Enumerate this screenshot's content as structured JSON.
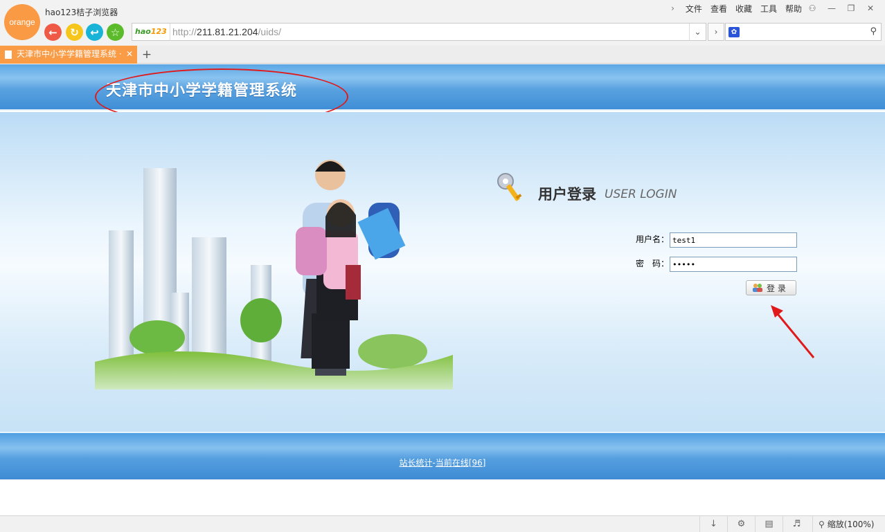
{
  "browser": {
    "logo_text": "orange",
    "app_name": "hao123桔子浏览器",
    "menu": [
      "文件",
      "查看",
      "收藏",
      "工具",
      "帮助"
    ],
    "address": {
      "brand_h": "hao",
      "brand_n": "123",
      "scheme": "http://",
      "host": "211.81.21.204",
      "path": "/uids/"
    },
    "tab": {
      "title": "天津市中小学学籍管理系统 ·"
    },
    "status": {
      "zoom": "缩放(100%)"
    }
  },
  "page": {
    "system_title": "天津市中小学学籍管理系统",
    "login": {
      "title": "用户登录",
      "subtitle": "USER LOGIN",
      "username_label": "用户名：",
      "password_label": "密　码：",
      "username_value": "test1",
      "password_value": "12345",
      "submit_label": "登 录"
    },
    "footer": {
      "stats_link": "站长统计",
      "separator": "-",
      "online_link": "当前在线[96]"
    }
  },
  "colors": {
    "accent_orange": "#fa9b46",
    "header_blue": "#5aa6e4",
    "annotation_red": "#e01a1a"
  }
}
